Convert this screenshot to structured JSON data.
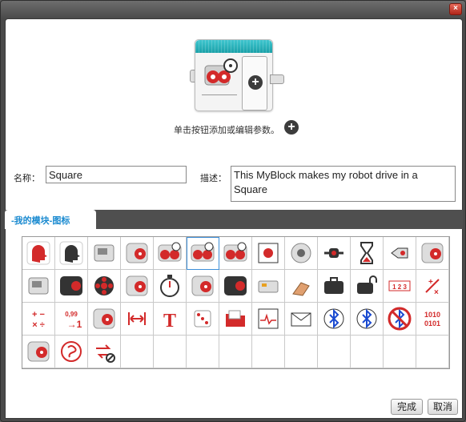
{
  "window": {
    "close_symbol": "×"
  },
  "preview": {
    "hint": "单击按钮添加或编辑参数。",
    "plus_symbol": "+"
  },
  "form": {
    "name_label": "名称：",
    "name_value": "Square",
    "desc_label": "描述：",
    "desc_value": "This MyBlock makes my robot drive in a Square"
  },
  "tabs": [
    {
      "label": "-我的模块-图标",
      "active": true
    }
  ],
  "icons": [
    "head-red-icon",
    "head-gears-icon",
    "brick-display-icon",
    "medium-motor-icon",
    "move-steering-icon",
    "move-steering-selected-icon",
    "move-tank-icon",
    "brick-target-icon",
    "sound-speaker-icon",
    "arrows-icon",
    "hourglass-icon",
    "color-sensor-icon",
    "motor-icon",
    "brick-icon",
    "dark-motor-icon",
    "brick-buttons-icon",
    "large-motor-icon",
    "timer-icon",
    "medium-motor-gray-icon",
    "dark-motor-2-icon",
    "keyboard-icon",
    "hand-icon",
    "briefcase-icon",
    "lock-icon",
    "numbers-icon",
    "math-cross-icon",
    "math-operations-icon",
    "number-arrow-icon",
    "motor-rotation-icon",
    "range-arrows-icon",
    "text-icon",
    "random-dice-icon",
    "folder-icon",
    "graph-icon",
    "envelope-icon",
    "bluetooth-icon",
    "bluetooth-wrench-icon",
    "no-bluetooth-icon",
    "binary-icon",
    "motor-rotate-icon",
    "red-rotation-icon",
    "invert-icon"
  ],
  "selected_icon_index": 5,
  "total_cells": 52,
  "buttons": {
    "done": "完成",
    "cancel": "取消"
  },
  "colors": {
    "accent": "#1a8ad0",
    "teal": "#1aa0a8",
    "red": "#d32a2a"
  }
}
